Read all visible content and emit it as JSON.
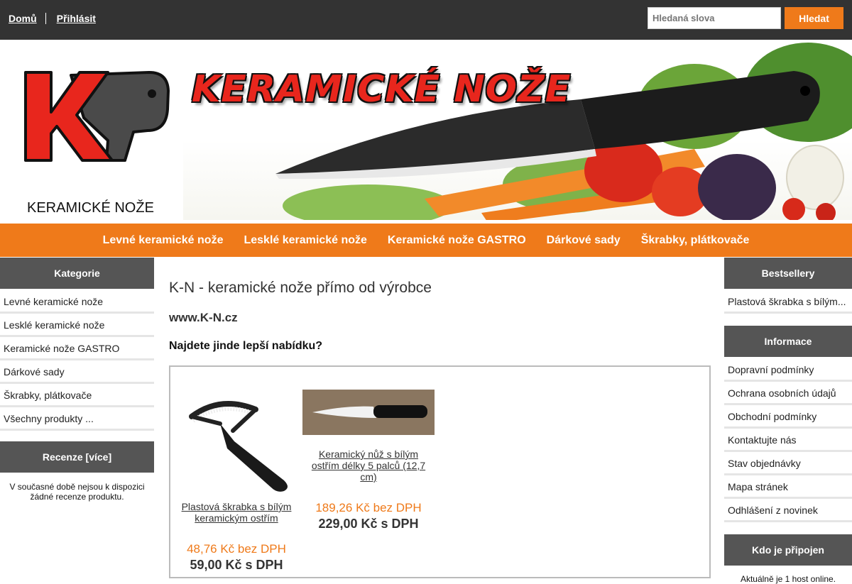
{
  "topbar": {
    "links": [
      "Domů",
      "Přihlásit"
    ],
    "search_placeholder": "Hledaná slova",
    "search_button": "Hledat"
  },
  "header": {
    "site_name": "KERAMICKÉ NOŽE",
    "banner_title": "KERAMICKÉ NOŽE"
  },
  "nav": {
    "items": [
      "Levné keramické nože",
      "Lesklé keramické nože",
      "Keramické nože GASTRO",
      "Dárkové sady",
      "Škrabky, plátkovače"
    ]
  },
  "left_sidebar": {
    "categories_title": "Kategorie",
    "categories": [
      "Levné keramické nože",
      "Lesklé keramické nože",
      "Keramické nože GASTRO",
      "Dárkové sady",
      "Škrabky, plátkovače",
      "Všechny produkty ..."
    ],
    "reviews_title": "Recenze  [více]",
    "reviews_note": "V současné době nejsou k dispozici žádné recenze produktu."
  },
  "main": {
    "title": "K-N - keramické nože přímo od výrobce",
    "url": "www.K-N.cz",
    "question": "Najdete jinde lepší nabídku?",
    "products": [
      {
        "name": "Plastová škrabka s bílým keramickým ostřím",
        "price_ex": "48,76 Kč bez DPH",
        "price_in": "59,00 Kč s DPH"
      },
      {
        "name": "Keramický nůž s bílým ostřím délky 5 palců (12,7 cm)",
        "price_ex": "189,26 Kč bez DPH",
        "price_in": "229,00 Kč s DPH"
      }
    ]
  },
  "right_sidebar": {
    "bestsellers_title": "Bestsellery",
    "bestsellers": [
      "Plastová škrabka s bílým..."
    ],
    "info_title": "Informace",
    "info_items": [
      "Dopravní podmínky",
      "Ochrana osobních údajů",
      "Obchodní podmínky",
      "Kontaktujte nás",
      "Stav objednávky",
      "Mapa stránek",
      "Odhlášení z novinek"
    ],
    "online_title": "Kdo je připojen",
    "online_text": "Aktuálně je 1 host online."
  }
}
